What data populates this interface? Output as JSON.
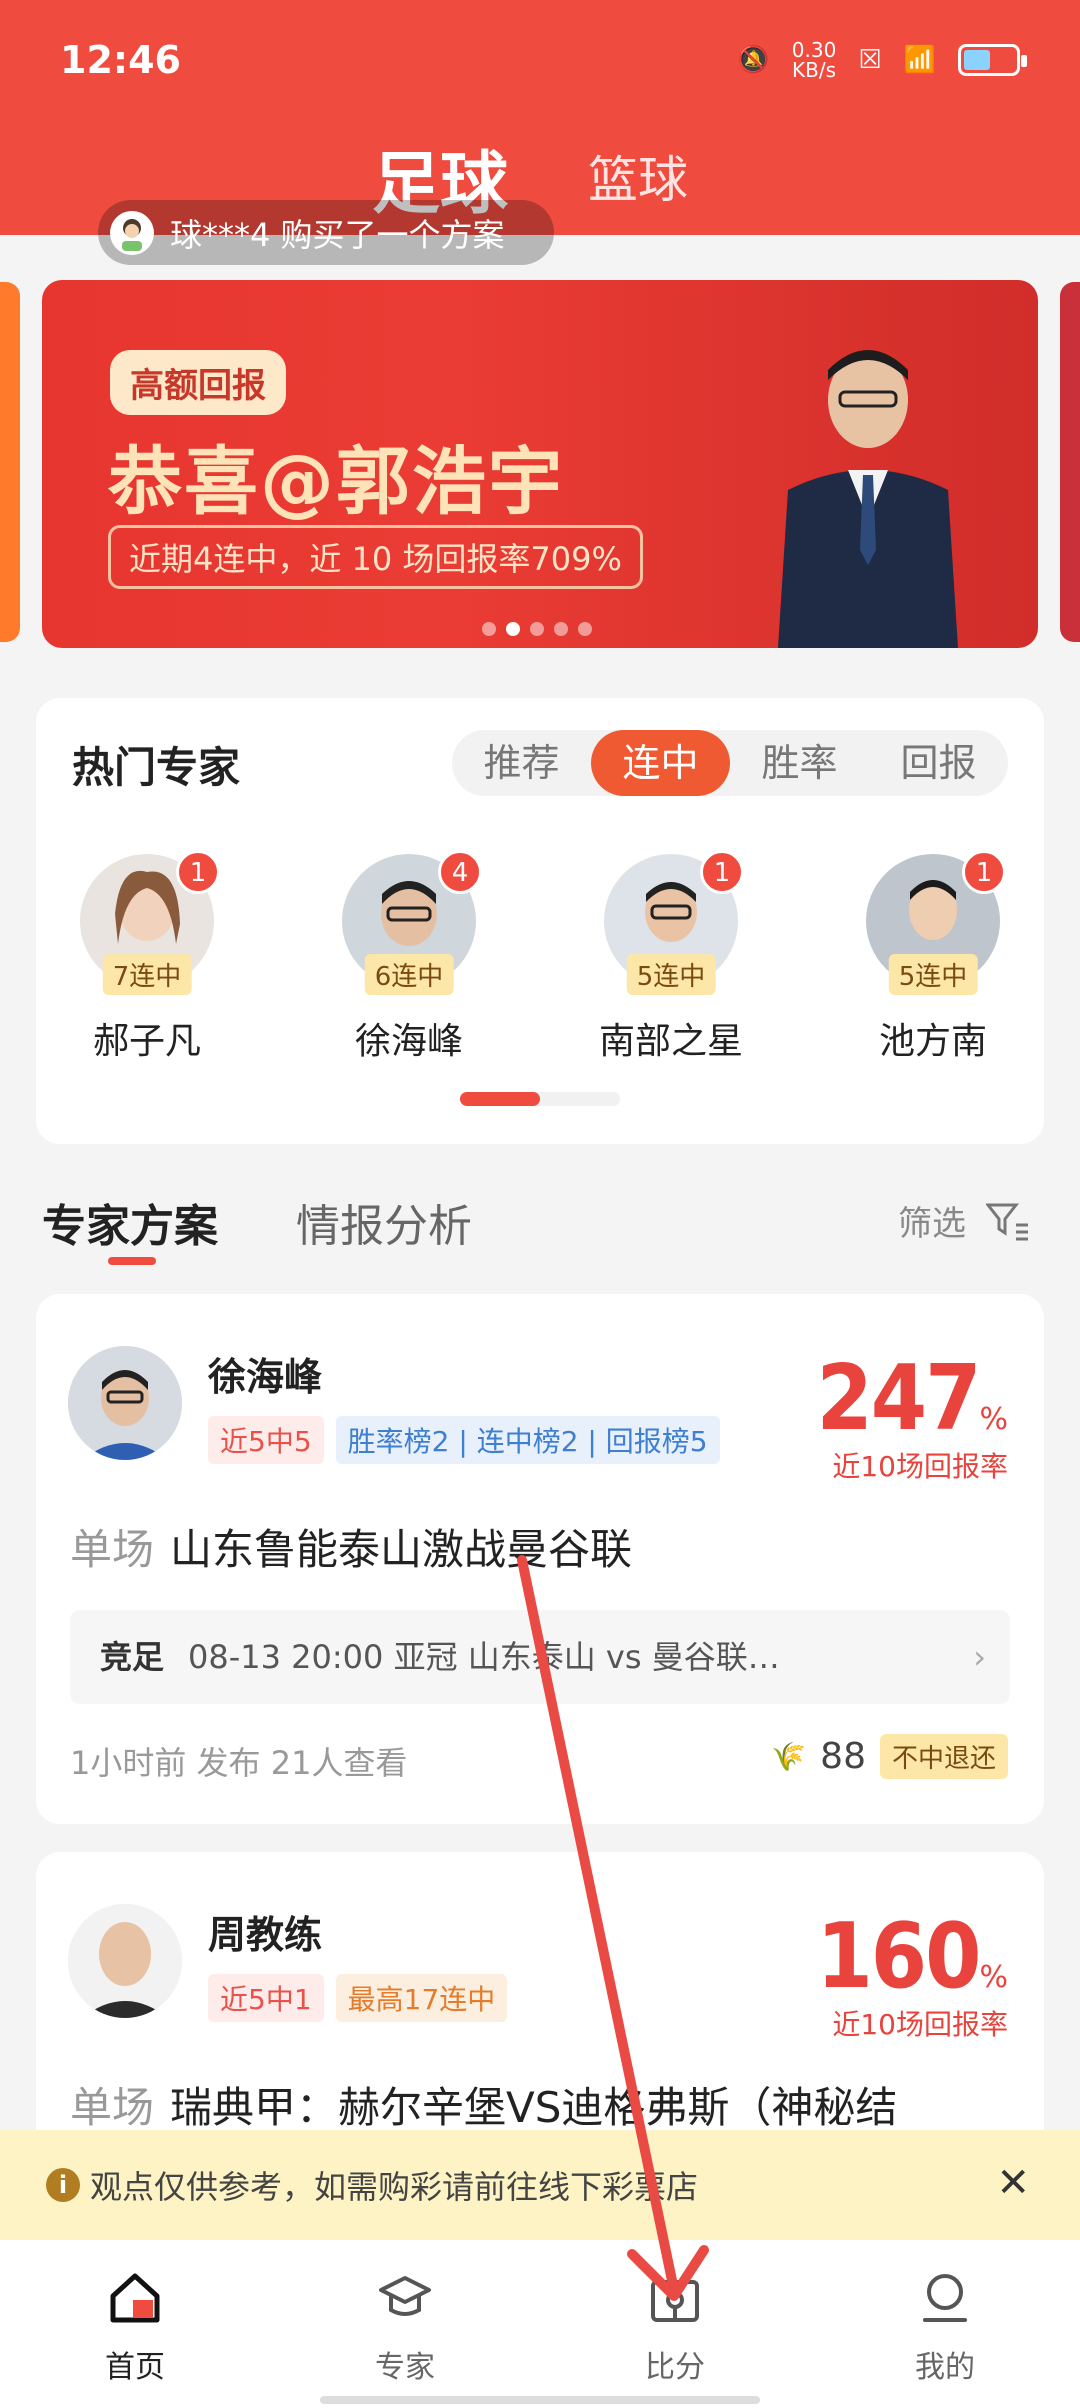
{
  "status": {
    "time": "12:46",
    "net_speed": "0.30\nKB/s"
  },
  "top_tabs": {
    "active": "足球",
    "other": "篮球"
  },
  "marquee": {
    "text": "球***4 购买了一个方案"
  },
  "banner": {
    "pill": "高额回报",
    "headline": "恭喜@郭浩宇",
    "subline": "近期4连中，近 10 场回报率709%"
  },
  "hot": {
    "title": "热门专家",
    "segments": [
      "推荐",
      "连中",
      "胜率",
      "回报"
    ],
    "active_segment": 1,
    "experts": [
      {
        "name": "郝子凡",
        "streak": "7连中",
        "badge": "1"
      },
      {
        "name": "徐海峰",
        "streak": "6连中",
        "badge": "4"
      },
      {
        "name": "南部之星",
        "streak": "5连中",
        "badge": "1"
      },
      {
        "name": "池方南",
        "streak": "5连中",
        "badge": "1"
      }
    ]
  },
  "section": {
    "tab1": "专家方案",
    "tab2": "情报分析",
    "filter": "筛选"
  },
  "plans": [
    {
      "name": "徐海峰",
      "tags": [
        {
          "text": "近5中5",
          "style": "red"
        },
        {
          "text": "胜率榜2 | 连中榜2 | 回报榜5",
          "style": "blue"
        }
      ],
      "rate": "247",
      "rate_unit": "%",
      "rate_label": "近10场回报率",
      "type": "单场",
      "title": "山东鲁能泰山激战曼谷联",
      "league_tag": "竞足",
      "match": "08-13 20:00  亚冠   山东泰山 vs 曼谷联…",
      "posted": "1小时前 发布   21人查看",
      "price": "88",
      "refund": "不中退还"
    },
    {
      "name": "周教练",
      "tags": [
        {
          "text": "近5中1",
          "style": "red"
        },
        {
          "text": "最高17连中",
          "style": "orange"
        }
      ],
      "rate": "160",
      "rate_unit": "%",
      "rate_label": "近10场回报率",
      "type": "单场",
      "title": "瑞典甲：赫尔辛堡VS迪格弗斯（神秘结"
    }
  ],
  "notice": {
    "text": "观点仅供参考，如需购彩请前往线下彩票店"
  },
  "bottom_nav": [
    "首页",
    "专家",
    "比分",
    "我的"
  ]
}
